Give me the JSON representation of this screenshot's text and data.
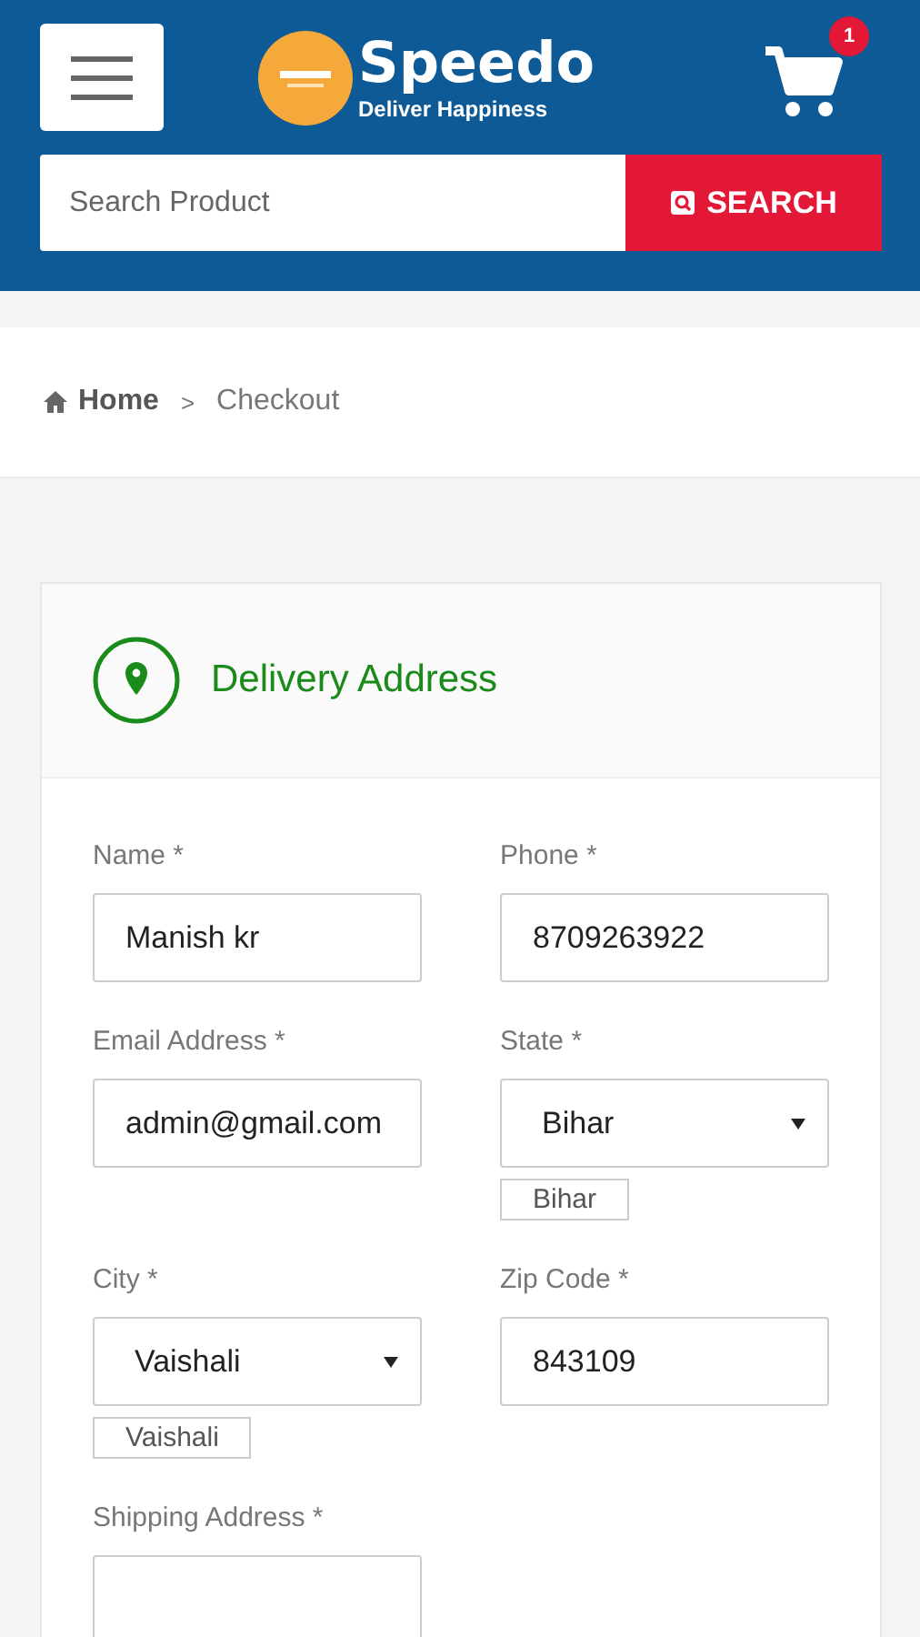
{
  "header": {
    "brand": "Speedo",
    "tagline": "Deliver Happiness",
    "cart_count": "1",
    "search": {
      "placeholder": "Search Product",
      "button": "SEARCH"
    }
  },
  "breadcrumb": [
    {
      "label": "Home",
      "current": false
    },
    {
      "label": "Checkout",
      "current": true
    }
  ],
  "breadcrumb_separator": ">",
  "section": {
    "title": "Delivery Address"
  },
  "fields": [
    {
      "kind": "input",
      "label": "Name *",
      "value": "Manish kr"
    },
    {
      "kind": "input",
      "label": "Phone *",
      "value": "8709263922"
    },
    {
      "kind": "input",
      "label": "Email Address *",
      "value": "admin@gmail.com"
    },
    {
      "kind": "select",
      "label": "State *",
      "value": "Bihar",
      "tag": "Bihar"
    },
    {
      "kind": "select",
      "label": "City *",
      "value": "Vaishali",
      "tag": "Vaishali"
    },
    {
      "kind": "input",
      "label": "Zip Code *",
      "value": "843109"
    },
    {
      "kind": "input",
      "label": "Shipping Address *"
    }
  ]
}
